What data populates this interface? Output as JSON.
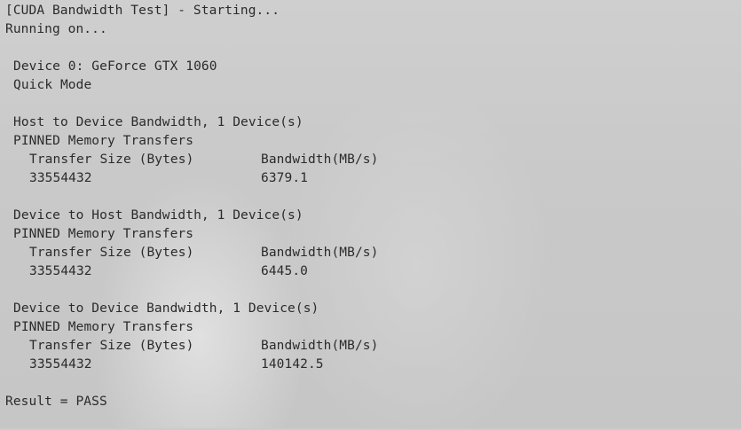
{
  "console": {
    "header": "[CUDA Bandwidth Test] - Starting...",
    "running": "Running on...",
    "device": "Device 0: GeForce GTX 1060",
    "mode": "Quick Mode",
    "sections": [
      {
        "title": "Host to Device Bandwidth, 1 Device(s)",
        "memory": "PINNED Memory Transfers",
        "col_size": "Transfer Size (Bytes)",
        "col_bw": "Bandwidth(MB/s)",
        "size": "33554432",
        "bandwidth": "6379.1"
      },
      {
        "title": "Device to Host Bandwidth, 1 Device(s)",
        "memory": "PINNED Memory Transfers",
        "col_size": "Transfer Size (Bytes)",
        "col_bw": "Bandwidth(MB/s)",
        "size": "33554432",
        "bandwidth": "6445.0"
      },
      {
        "title": "Device to Device Bandwidth, 1 Device(s)",
        "memory": "PINNED Memory Transfers",
        "col_size": "Transfer Size (Bytes)",
        "col_bw": "Bandwidth(MB/s)",
        "size": "33554432",
        "bandwidth": "140142.5"
      }
    ],
    "result": "Result = PASS"
  }
}
